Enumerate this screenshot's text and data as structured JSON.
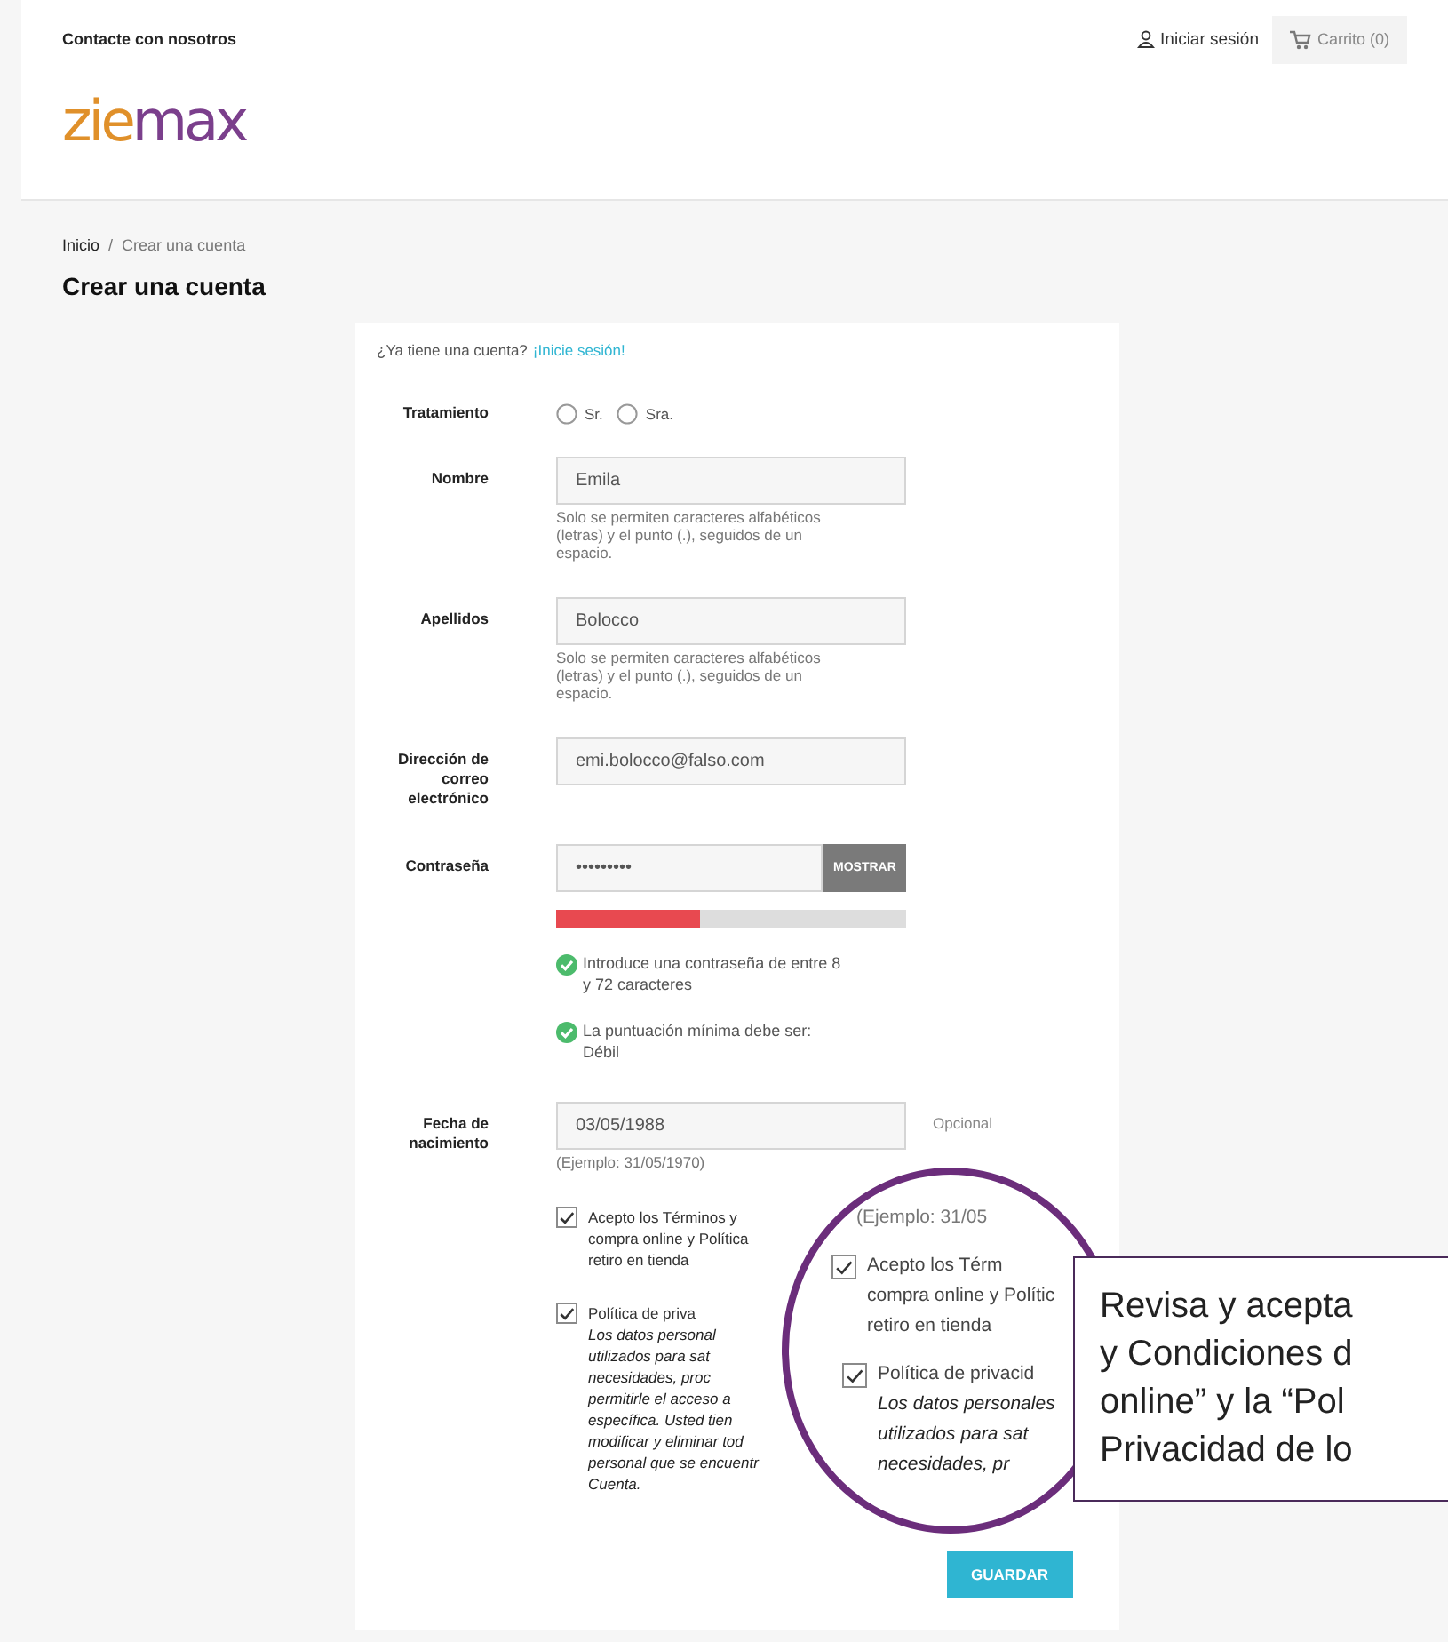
{
  "top_bar": {
    "contact_link": "Contacte con nosotros",
    "sign_in_link": "Iniciar sesión",
    "cart_link": "Carrito (0)"
  },
  "logo": [
    {
      "text": "zie",
      "color": "#e0902a"
    },
    {
      "text": "max",
      "color": "#7b3f8c"
    }
  ],
  "breadcrumb": [
    {
      "label": "Inicio"
    },
    {
      "label": "Crear una cuenta"
    }
  ],
  "breadcrumb_separator": "/",
  "page_title": "Crear una cuenta",
  "form": {
    "login_prompt": "¿Ya tiene una cuenta?",
    "login_link": "¡Inicie sesión!",
    "title_field": {
      "label": "Tratamiento",
      "options": [
        {
          "label": "Sr.",
          "selected": false
        },
        {
          "label": "Sra.",
          "selected": false
        }
      ]
    },
    "fields": [
      {
        "kind": "text",
        "label": "Nombre",
        "value": "Emila",
        "hint": "Solo se permiten caracteres alfabéticos (letras) y el punto (.), seguidos de un espacio."
      },
      {
        "kind": "text",
        "label": "Apellidos",
        "value": "Bolocco",
        "hint": "Solo se permiten caracteres alfabéticos (letras) y el punto (.), seguidos de un espacio."
      },
      {
        "kind": "text",
        "label": "Dirección de correo electrónico",
        "value": "emi.bolocco@falso.com"
      },
      {
        "kind": "password",
        "label": "Contraseña",
        "value": "•••••••••",
        "button": "MOSTRAR",
        "strength": {
          "level": 0.41
        },
        "rules": [
          {
            "text": "Introduce una contraseña de entre 8 y 72 caracteres",
            "met": true
          },
          {
            "text": "La puntuación mínima debe ser: Débil",
            "met": true
          }
        ]
      },
      {
        "kind": "text",
        "label": "Fecha de nacimiento",
        "value": "03/05/1988",
        "hint": "(Ejemplo: 31/05/1970)",
        "note": "Opcional"
      }
    ],
    "consents": [
      {
        "checked": true,
        "lines": [
          "Acepto los Términos y",
          "compra online y Política",
          "retiro en tienda"
        ]
      },
      {
        "checked": true,
        "lines": [
          "Política de priva"
        ],
        "detail_lines": [
          "Los datos personal",
          "utilizados para sat",
          "necesidades, proc",
          "permitirle el acceso a",
          "específica. Usted tien",
          "modificar y eliminar tod",
          "personal que se encuentr",
          "Cuenta."
        ]
      }
    ],
    "submit": "GUARDAR"
  },
  "magnifier": {
    "example": "(Ejemplo: 31/05",
    "consents": [
      {
        "checked": true,
        "lines": [
          "Acepto los Térm",
          "compra online y Polític",
          "retiro en tienda"
        ]
      },
      {
        "checked": true,
        "lines": [
          "Política de privacid"
        ],
        "detail_lines": [
          "Los datos personales",
          "utilizados para sat",
          "necesidades, pr"
        ]
      }
    ]
  },
  "callout": {
    "lines": [
      "Revisa y acepta",
      "y Condiciones d",
      "online” y la “Pol",
      "Privacidad de lo"
    ]
  }
}
